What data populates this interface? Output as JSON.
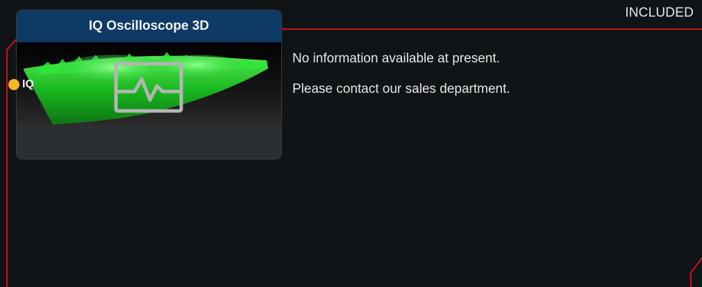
{
  "status_badge": "INCLUDED",
  "module": {
    "title": "IQ Oscilloscope 3D",
    "input_port_label": "IQ",
    "icon": "oscilloscope-waveform-icon"
  },
  "info": {
    "line1": "No information available at present.",
    "line2": "Please contact our sales department."
  },
  "colors": {
    "background": "#111416",
    "frame_accent": "#c4161c",
    "card_header": "#0f3a66",
    "port_dot": "#f5b724",
    "surface_green": "#1ecf2a"
  }
}
